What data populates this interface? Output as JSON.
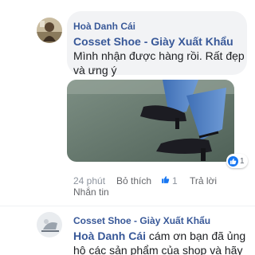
{
  "comment": {
    "author": "Hoà Danh Cái",
    "mention": "Cosset Shoe - Giày Xuất Khẩu",
    "text_line_1": "Mình nhận được hàng rồi. Rất đẹp",
    "text_line_2": "và ưng ý",
    "reaction_count": "1",
    "time": "24 phút",
    "like_label": "Bỏ thích",
    "like_count": "1",
    "reply_label": "Trả lời",
    "message_label": "Nhắn tin"
  },
  "reply": {
    "author": "Cosset Shoe - Giày Xuất Khẩu",
    "mention": "Hoà Danh Cái",
    "text_line_1_rest": " cám ơn bạn đã ủng",
    "text_line_2": "hộ các sản phẩm của shop  và hãy"
  },
  "colors": {
    "link": "#385898",
    "bubble": "#f2f3f5",
    "like_blue": "#1877f2",
    "meta": "#8d949e"
  },
  "icons": {
    "reaction": "thumbs-up-icon",
    "like_count": "thumbs-up-icon"
  }
}
